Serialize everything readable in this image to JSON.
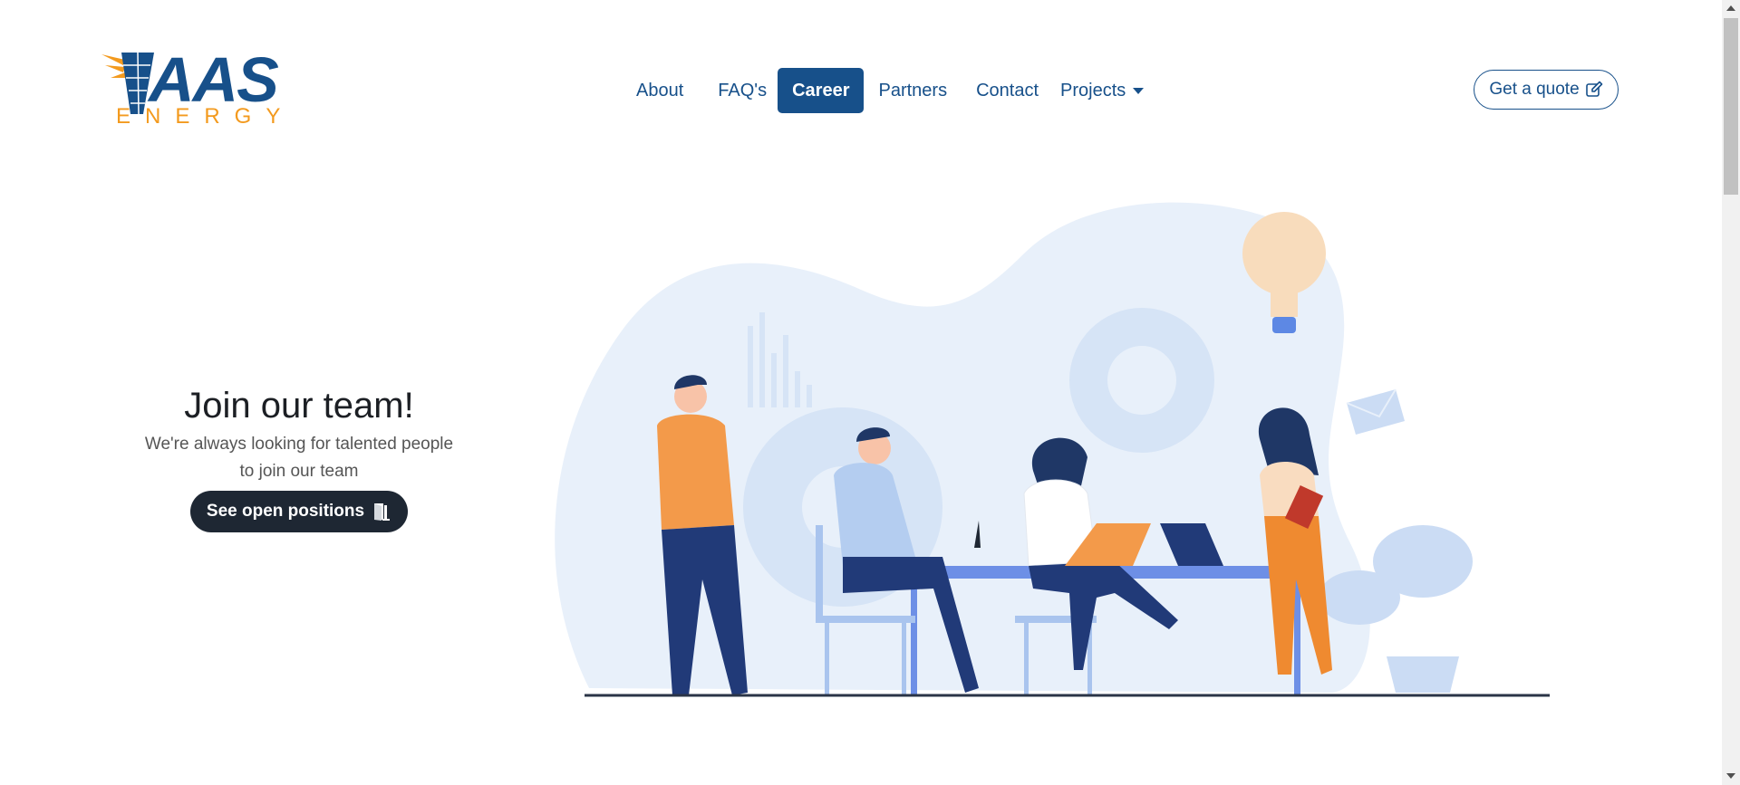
{
  "brand": {
    "logo_main": "AAS",
    "logo_sub": "ENERGY"
  },
  "nav": {
    "items": [
      {
        "label": "About"
      },
      {
        "label": "FAQ's"
      },
      {
        "label": "Career",
        "active": true
      },
      {
        "label": "Partners"
      },
      {
        "label": "Contact"
      },
      {
        "label": "Projects"
      }
    ],
    "quote_button": "Get a quote"
  },
  "hero": {
    "title": "Join our team!",
    "subtitle_line1": "We're always looking for talented people",
    "subtitle_line2": "to join our team",
    "cta": "See open positions"
  },
  "colors": {
    "brand_blue": "#17508a",
    "brand_orange": "#f39a1e",
    "dark": "#1e2733",
    "illustration_bg": "#e8f0fa"
  },
  "icons": {
    "quote": "edit-icon",
    "cta": "door-icon",
    "dropdown": "caret-down-icon"
  }
}
